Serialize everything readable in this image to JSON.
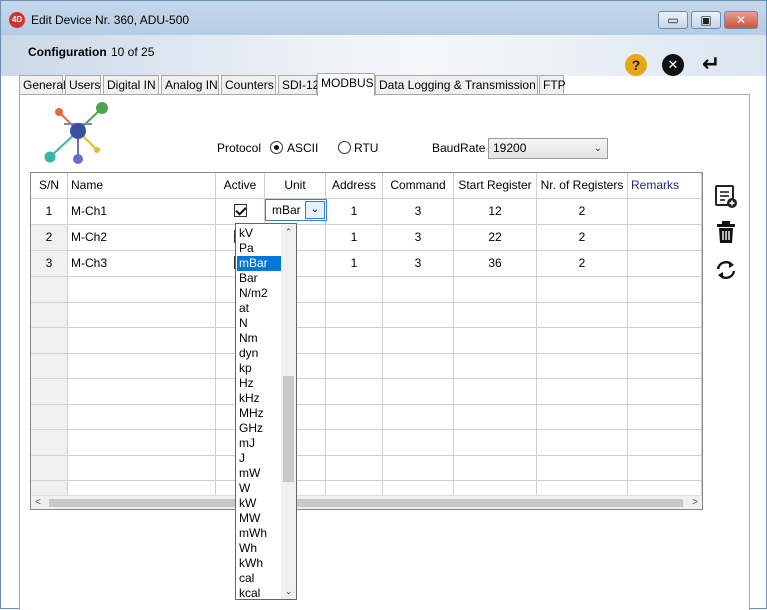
{
  "window": {
    "app_icon_text": "4D",
    "title": "Edit Device Nr. 360, ADU-500",
    "min_label": "▭",
    "max_label": "▣",
    "close_label": "✕"
  },
  "header": {
    "config_label": "Configuration",
    "config_count": "10 of 25",
    "help_icon": "?",
    "close_icon": "✕",
    "enter_icon": "↵"
  },
  "tabs": [
    {
      "label": "General"
    },
    {
      "label": "Users"
    },
    {
      "label": "Digital IN"
    },
    {
      "label": "Analog IN"
    },
    {
      "label": "Counters"
    },
    {
      "label": "SDI-12"
    },
    {
      "label": "MODBUS"
    },
    {
      "label": "Data Logging & Transmission"
    },
    {
      "label": "FTP"
    }
  ],
  "active_tab": "MODBUS",
  "protocol": {
    "label": "Protocol",
    "options": [
      "ASCII",
      "RTU"
    ],
    "selected": "ASCII"
  },
  "baud": {
    "label": "BaudRate",
    "value": "19200"
  },
  "table": {
    "headers": {
      "sn": "S/N",
      "name": "Name",
      "active": "Active",
      "unit": "Unit",
      "address": "Address",
      "command": "Command",
      "start": "Start Register",
      "nregs": "Nr. of Registers",
      "remarks": "Remarks"
    },
    "rows": [
      {
        "sn": "1",
        "name": "M-Ch1",
        "active": true,
        "unit": "mBar",
        "address": "1",
        "command": "3",
        "start": "12",
        "nregs": "2",
        "remarks": ""
      },
      {
        "sn": "2",
        "name": "M-Ch2",
        "active": true,
        "unit": "",
        "address": "1",
        "command": "3",
        "start": "22",
        "nregs": "2",
        "remarks": ""
      },
      {
        "sn": "3",
        "name": "M-Ch3",
        "active": true,
        "unit": "",
        "address": "1",
        "command": "3",
        "start": "36",
        "nregs": "2",
        "remarks": ""
      }
    ]
  },
  "unit_dropdown": {
    "selected": "mBar",
    "items": [
      "kV",
      "Pa",
      "mBar",
      "Bar",
      "N/m2",
      "at",
      "N",
      "Nm",
      "dyn",
      "kp",
      "Hz",
      "kHz",
      "MHz",
      "GHz",
      "mJ",
      "J",
      "mW",
      "W",
      "kW",
      "MW",
      "mWh",
      "Wh",
      "kWh",
      "cal",
      "kcal"
    ]
  },
  "icons": {
    "logo": "network-logo-icon",
    "add": "add-row-icon",
    "delete": "trash-icon",
    "refresh": "refresh-icon",
    "accent": "#0078d7"
  }
}
